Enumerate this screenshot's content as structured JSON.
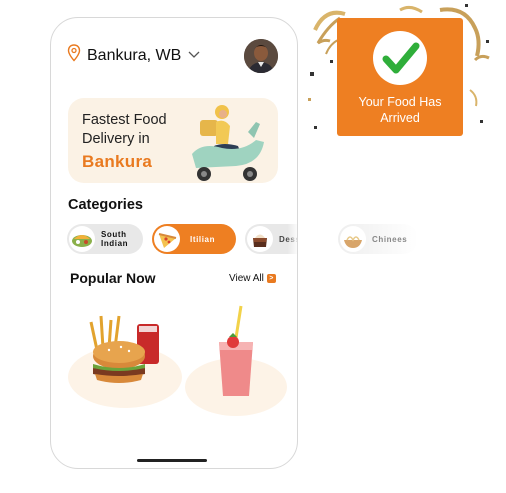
{
  "header": {
    "location": "Bankura, WB"
  },
  "banner": {
    "line1": "Fastest Food",
    "line2": "Delivery in",
    "city": "Bankura"
  },
  "categories": {
    "title": "Categories",
    "items": [
      {
        "line1": "South",
        "line2": "Indian"
      },
      {
        "line1": "Itilian"
      },
      {
        "line1": "Desserts"
      },
      {
        "line1": "Chinees"
      }
    ]
  },
  "popular": {
    "title": "Popular Now",
    "view_all": "View All",
    "view_all_icon": ">"
  },
  "notification": {
    "line1": "Your Food Has",
    "line2": "Arrived"
  },
  "colors": {
    "accent": "#e97a20",
    "notification": "#ee7f22",
    "banner_bg": "#fbf2e5"
  }
}
